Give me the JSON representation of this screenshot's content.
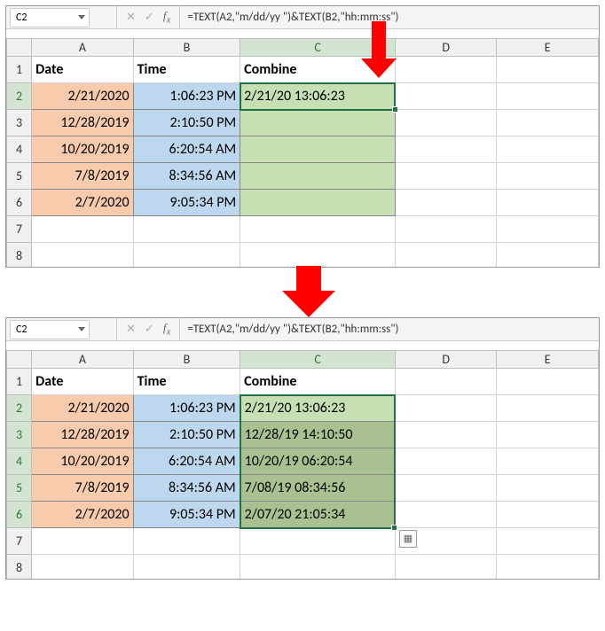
{
  "nameBox": "C2",
  "formula": "=TEXT(A2,\"m/dd/yy \")&TEXT(B2,\"hh:mm:ss\")",
  "columns": [
    "A",
    "B",
    "C",
    "D",
    "E"
  ],
  "headers": {
    "A": "Date",
    "B": "Time",
    "C": "Combine"
  },
  "rows": [
    {
      "n": "2",
      "date": "2/21/2020",
      "time": "1:06:23 PM",
      "combine": "2/21/20 13:06:23"
    },
    {
      "n": "3",
      "date": "12/28/2019",
      "time": "2:10:50 PM",
      "combine": "12/28/19 14:10:50"
    },
    {
      "n": "4",
      "date": "10/20/2019",
      "time": "6:20:54 AM",
      "combine": "10/20/19 06:20:54"
    },
    {
      "n": "5",
      "date": "7/8/2019",
      "time": "8:34:56 AM",
      "combine": "7/08/19 08:34:56"
    },
    {
      "n": "6",
      "date": "2/7/2020",
      "time": "9:05:34 PM",
      "combine": "2/07/20 21:05:34"
    }
  ],
  "rowsTail": [
    "7",
    "8"
  ],
  "rowOne": "1"
}
